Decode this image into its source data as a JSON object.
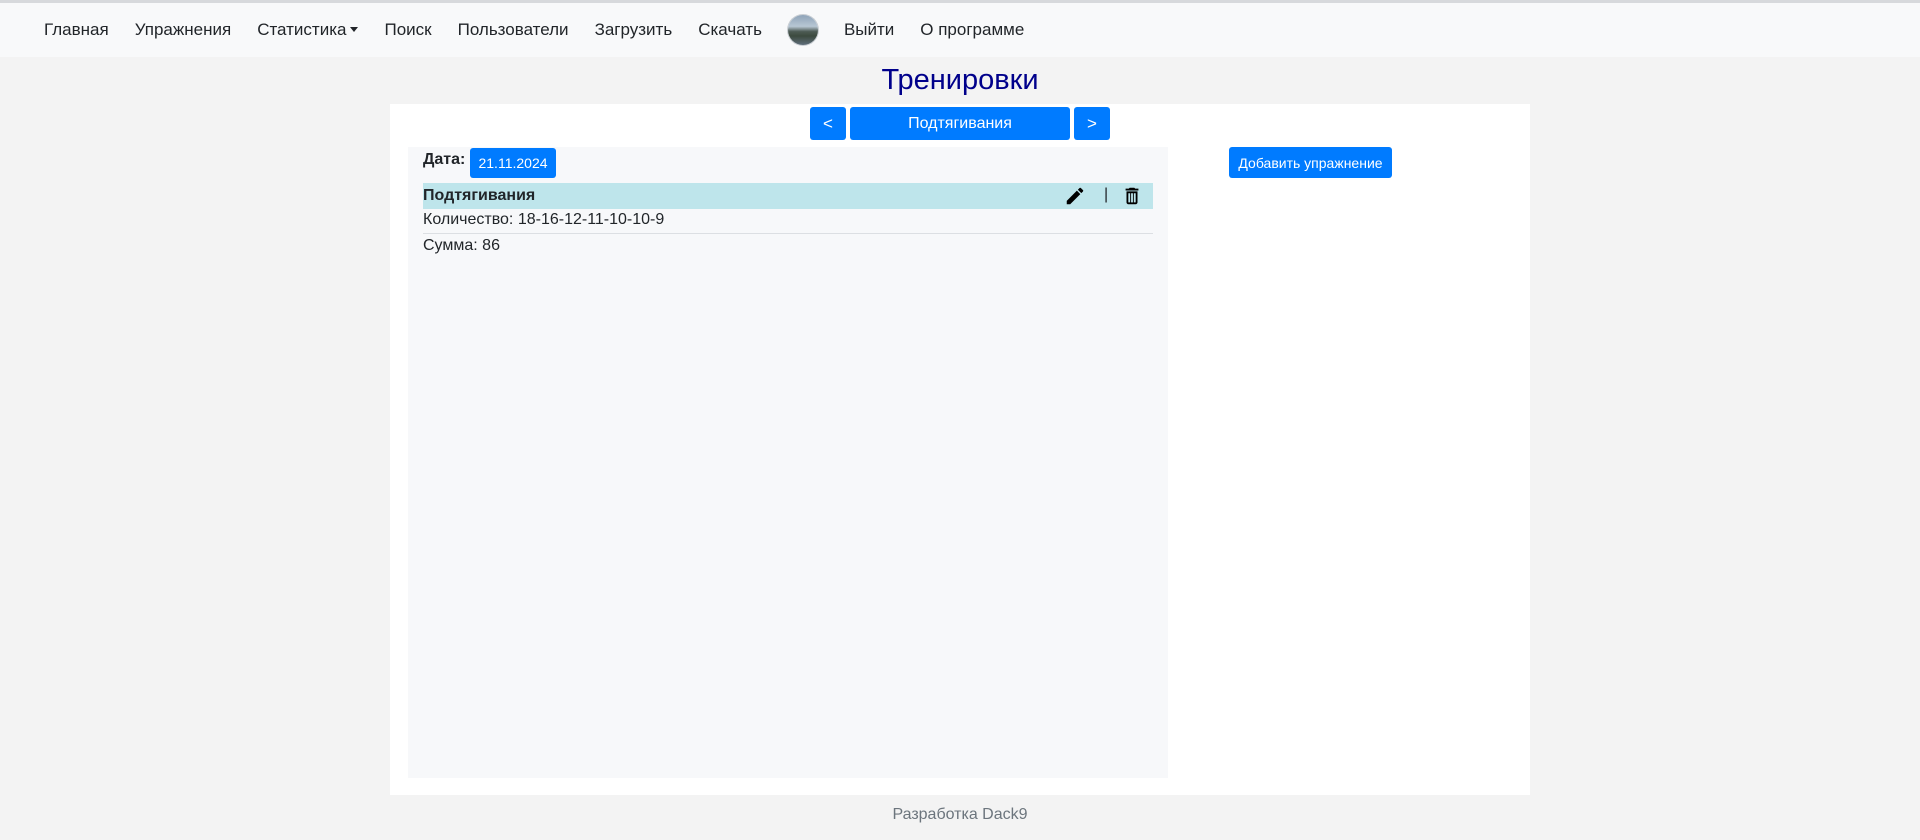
{
  "nav": {
    "items": [
      "Главная",
      "Упражнения",
      "Статистика",
      "Поиск",
      "Пользователи",
      "Загрузить",
      "Скачать"
    ],
    "after_avatar": [
      "Выйти",
      "О программе"
    ]
  },
  "page": {
    "title": "Тренировки"
  },
  "exercise_selector": {
    "prev": "<",
    "current": "Подтягивания",
    "next": ">"
  },
  "workout": {
    "date_label": "Дата:",
    "date_value": "21.11.2024",
    "exercise_name": "Подтягивания",
    "separator": "|",
    "quantity": "Количество: 18-16-12-11-10-10-9",
    "sum": "Сумма: 86"
  },
  "actions": {
    "add_exercise": "Добавить упражнение"
  },
  "footer": {
    "text": "Разработка Dack9"
  },
  "colors": {
    "accent": "#007bff",
    "title": "#00008b",
    "row_highlight": "#bee5eb"
  },
  "icons": {
    "edit": "pencil-icon",
    "delete": "trash-icon"
  }
}
